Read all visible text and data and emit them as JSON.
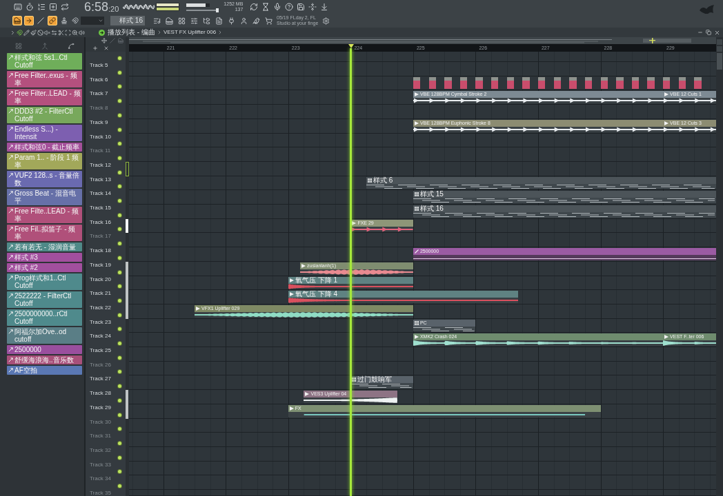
{
  "toolbar": {
    "time_main": "6:58",
    "time_fraction": ":20",
    "master_volume": {
      "level": 0.8
    },
    "master_pitch": {
      "level": 0.96
    },
    "memory": "1252 MB",
    "polyphony": "137"
  },
  "tools": {
    "toggles": [
      {
        "on": true
      },
      {
        "on": true
      },
      {
        "on": false
      },
      {
        "on": true
      },
      {
        "on": false
      }
    ],
    "pattern": "样式 16",
    "hint": [
      "05/19 FLday 2, FL",
      "Studio at your finge"
    ]
  },
  "playlist": {
    "breadcrumb": [
      "播放列表 - 编曲",
      "VEST FX Uplifter 006"
    ],
    "ruler": [
      "221",
      "222",
      "223",
      "224",
      "225",
      "226",
      "227",
      "228",
      "229"
    ]
  },
  "patterns": [
    {
      "name": "样式和弦 5s1..Ctl Cutoff",
      "color": "#6fae5a"
    },
    {
      "name": "Free Filter..exus - 频率",
      "color": "#b4507e"
    },
    {
      "name": "Free Filter..LEAD - 频率",
      "color": "#b4507e"
    },
    {
      "name": "DDD3 #2 - FilterCtl Cutoff",
      "color": "#78a85c"
    },
    {
      "name": "Endless S...) - Intensit",
      "color": "#7d5fb0"
    },
    {
      "name": "样式和弦0 - 截止频率",
      "color": "#a4509a"
    },
    {
      "name": "Param 1.. - 阶段 1 频率",
      "color": "#a2a85a"
    },
    {
      "name": "VUF2 128..s - 音量倍数",
      "color": "#6a6ab0"
    },
    {
      "name": "Gross Beat - 混音电平",
      "color": "#6670a8"
    },
    {
      "name": "Free Filte..LEAD - 频率",
      "color": "#b0507a"
    },
    {
      "name": "Free Fil..拟笛子 - 频率",
      "color": "#b0507a"
    },
    {
      "name": "若有若无 - 湿润音量",
      "color": "#4f8a88"
    },
    {
      "name": "样式 #3",
      "color": "#a24f9e"
    },
    {
      "name": "样式 #2",
      "color": "#a24f9e"
    },
    {
      "name": "Prog样式和1..Ctl Cutoff",
      "color": "#4f8a8c"
    },
    {
      "name": "2522222 - FilterCtl Cutoff",
      "color": "#4f8a8c"
    },
    {
      "name": "2500000000..rCtl Cutoff",
      "color": "#4f8a8c"
    },
    {
      "name": "阿福尔加Ove..od cutoff",
      "color": "#5a7e86"
    },
    {
      "name": "2500000",
      "color": "#9a4f9e"
    },
    {
      "name": "舒缓海浪海..音乐数",
      "color": "#a8507a"
    },
    {
      "name": "AF空拍",
      "color": "#5a78b4"
    }
  ],
  "tracks": [
    {
      "mute_on": true
    },
    {
      "name": "Track 5",
      "dimmed": false,
      "mute_on": true
    },
    {
      "name": "Track 6",
      "dimmed": false,
      "mute_on": true,
      "clips": [
        {
          "kind": "blocks",
          "color": "#c94d6c"
        }
      ]
    },
    {
      "name": "Track 7",
      "dimmed": false,
      "mute_on": true,
      "clips": [
        {
          "kind": "hits",
          "name": "VBE 128BPM Cymbal Stroke 2",
          "color": "#7d8a93",
          "wave": {
            "color": "#e8ecef"
          }
        },
        {
          "kind": "hits",
          "name": "VBE 12 Cuts 1",
          "color": "#7d8a93",
          "wave": {
            "color": "#e8ecef"
          }
        }
      ]
    },
    {
      "name": "Track 8",
      "dimmed": true,
      "mute_on": true
    },
    {
      "name": "Track 9",
      "dimmed": false,
      "mute_on": true,
      "clips": [
        {
          "kind": "hits",
          "name": "VBE 128BPM Euphonic Stroke 8",
          "color": "#8c8c72",
          "wave": {
            "color": "#e8ecef"
          }
        },
        {
          "kind": "hits",
          "name": "VBE 12 Cuts 3",
          "color": "#8c8c72",
          "wave": {
            "color": "#e8ecef"
          }
        }
      ]
    },
    {
      "name": "Track 10",
      "dimmed": false,
      "mute_on": true
    },
    {
      "name": "Track 11",
      "dimmed": true,
      "mute_on": true
    },
    {
      "name": "Track 12",
      "dimmed": false,
      "mute_on": true,
      "marker": {
        "kind": "outline"
      }
    },
    {
      "name": "Track 13",
      "dimmed": false,
      "mute_on": true,
      "clips": [
        {
          "kind": "pattern",
          "name": "样式 6",
          "color": "#4c5459"
        }
      ]
    },
    {
      "name": "Track 14",
      "dimmed": false,
      "mute_on": true,
      "clips": [
        {
          "kind": "pattern",
          "name": "样式 15",
          "color": "#4c5459"
        }
      ]
    },
    {
      "name": "Track 15",
      "dimmed": false,
      "mute_on": true,
      "clips": [
        {
          "kind": "pattern",
          "name": "样式 16",
          "color": "#4c5459"
        }
      ]
    },
    {
      "name": "Track 16",
      "dimmed": false,
      "mute_on": true,
      "marker": {
        "kind": "solid"
      },
      "clips": [
        {
          "kind": "hits",
          "name": "FXE 29",
          "color": "#8e9678",
          "wave": {
            "color": "#e2627c"
          }
        }
      ]
    },
    {
      "name": "Track 17",
      "dimmed": true,
      "mute_on": true
    },
    {
      "name": "Track 18",
      "dimmed": false,
      "mute_on": true,
      "clips": [
        {
          "kind": "automation",
          "name": "2500000",
          "color": "#9b5ba3"
        }
      ]
    },
    {
      "name": "Track 19",
      "dimmed": false,
      "mute_on": true,
      "marker": {
        "kind": "faint"
      },
      "clips": [
        {
          "kind": "blob",
          "name": "zusianlanh(1)",
          "color": "#7f8d70",
          "wave": {
            "color": "#e88a90"
          }
        }
      ]
    },
    {
      "name": "Track 20",
      "dimmed": false,
      "mute_on": true,
      "marker": {
        "kind": "faint"
      },
      "clips": [
        {
          "kind": "decay",
          "name": "氧气压 下降 1",
          "color": "#5f8282",
          "wave": {
            "color": "#d9505e"
          }
        }
      ]
    },
    {
      "name": "Track 21",
      "dimmed": false,
      "mute_on": true,
      "marker": {
        "kind": "faint"
      },
      "clips": [
        {
          "kind": "decay",
          "name": "氧气压 下降 4",
          "color": "#5f8282",
          "wave": {
            "color": "#d9505e"
          }
        }
      ]
    },
    {
      "name": "Track 22",
      "dimmed": false,
      "mute_on": true,
      "marker": {
        "kind": "faint"
      },
      "clips": [
        {
          "kind": "blob",
          "name": "VFX1 Uplifter 029",
          "color": "#7f8a64",
          "wave": {
            "color": "#8fdcc4"
          }
        }
      ]
    },
    {
      "name": "Track 23",
      "dimmed": false,
      "mute_on": true,
      "clips": [
        {
          "kind": "pattern",
          "name": "PC",
          "color": "#59626a"
        }
      ]
    },
    {
      "name": "Track 24",
      "dimmed": false,
      "mute_on": true,
      "clips": [
        {
          "kind": "bursts",
          "name": "XMK2 Crash 024",
          "color": "#6f8c6e",
          "wave": {
            "color": "#9fe0cf"
          }
        },
        {
          "kind": "bursts",
          "name": "VEST F..ter 006",
          "color": "#6f8c6e",
          "wave": {
            "color": "#9fe0cf"
          }
        }
      ]
    },
    {
      "name": "Track 25",
      "dimmed": false,
      "mute_on": true
    },
    {
      "name": "Track 26",
      "dimmed": true,
      "mute_on": true
    },
    {
      "name": "Track 27",
      "dimmed": false,
      "mute_on": true,
      "clips": [
        {
          "kind": "pattern",
          "name": "过门鼓响军",
          "color": "#59626a"
        }
      ]
    },
    {
      "name": "Track 28",
      "dimmed": false,
      "mute_on": true,
      "marker": {
        "kind": "faint"
      },
      "clips": [
        {
          "kind": "swell",
          "name": "VES3 Uplifter 04",
          "color": "#8d7384",
          "wave": {
            "color": "#eef2f2"
          }
        }
      ]
    },
    {
      "name": "Track 29",
      "dimmed": false,
      "mute_on": true,
      "marker": {
        "kind": "faint"
      },
      "clips": [
        {
          "kind": "line",
          "name": "FX",
          "color": "#7e9072",
          "wave": {
            "color": "#79c9c0"
          }
        }
      ]
    },
    {
      "name": "Track 30",
      "dimmed": true,
      "mute_on": true
    },
    {
      "name": "Track 31",
      "dimmed": true,
      "mute_on": true
    },
    {
      "name": "Track 32",
      "dimmed": true,
      "mute_on": true
    },
    {
      "name": "Track 33",
      "dimmed": true,
      "mute_on": true
    },
    {
      "name": "Track 34",
      "dimmed": true,
      "mute_on": true
    },
    {
      "name": "Track 35",
      "dimmed": true
    }
  ]
}
